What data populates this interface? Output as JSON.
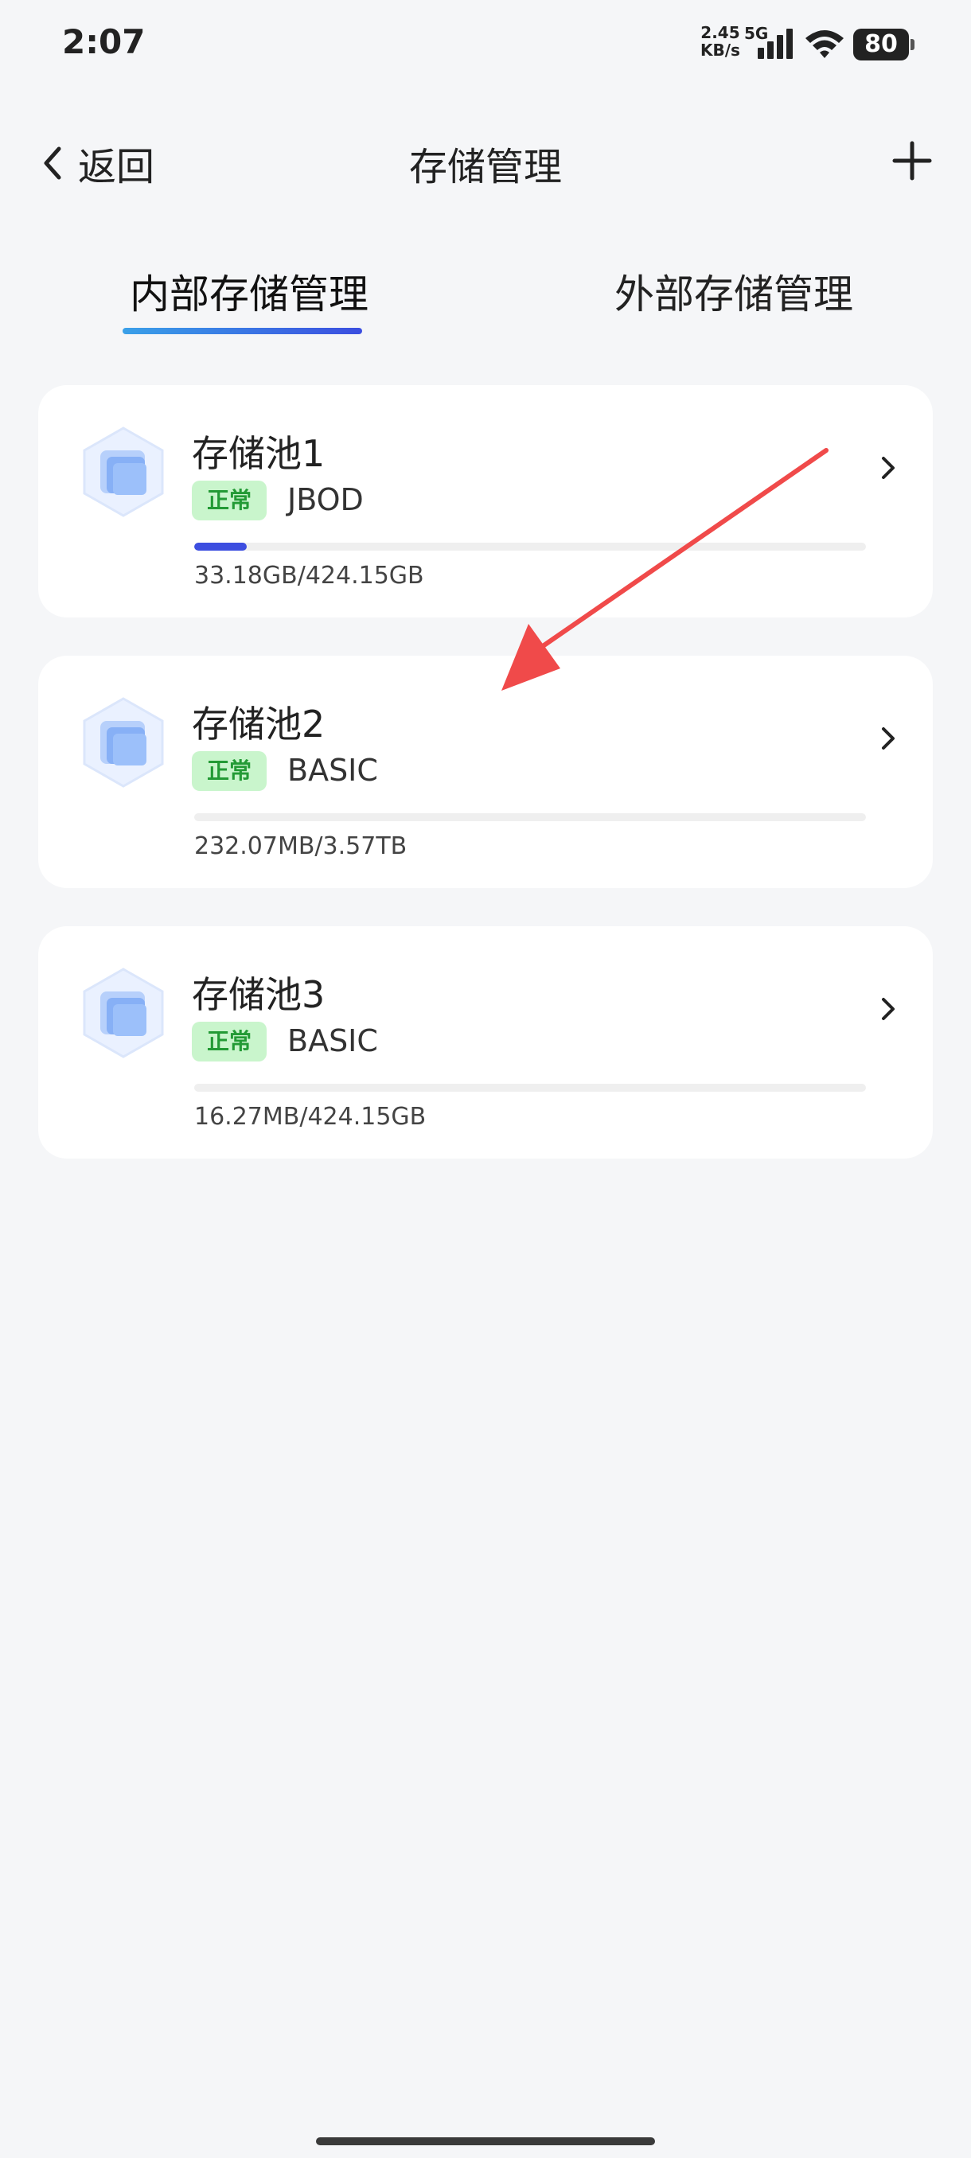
{
  "status_bar": {
    "time": "2:07",
    "net_speed_value": "2.45",
    "net_speed_unit": "KB/s",
    "network": "5G",
    "battery": "80"
  },
  "header": {
    "back_label": "返回",
    "title": "存储管理"
  },
  "tabs": [
    {
      "label": "内部存储管理",
      "active": true
    },
    {
      "label": "外部存储管理",
      "active": false
    }
  ],
  "pools": [
    {
      "name": "存储池1",
      "status": "正常",
      "type": "JBOD",
      "usage": "33.18GB/424.15GB",
      "usage_fraction": 0.078
    },
    {
      "name": "存储池2",
      "status": "正常",
      "type": "BASIC",
      "usage": "232.07MB/3.57TB",
      "usage_fraction": 0.0001
    },
    {
      "name": "存储池3",
      "status": "正常",
      "type": "BASIC",
      "usage": "16.27MB/424.15GB",
      "usage_fraction": 4e-05
    }
  ],
  "colors": {
    "accent": "#3d4ee0",
    "status_green": "#239a35",
    "status_bg": "#c9f5cc",
    "annotation_arrow": "#f04a4a"
  }
}
